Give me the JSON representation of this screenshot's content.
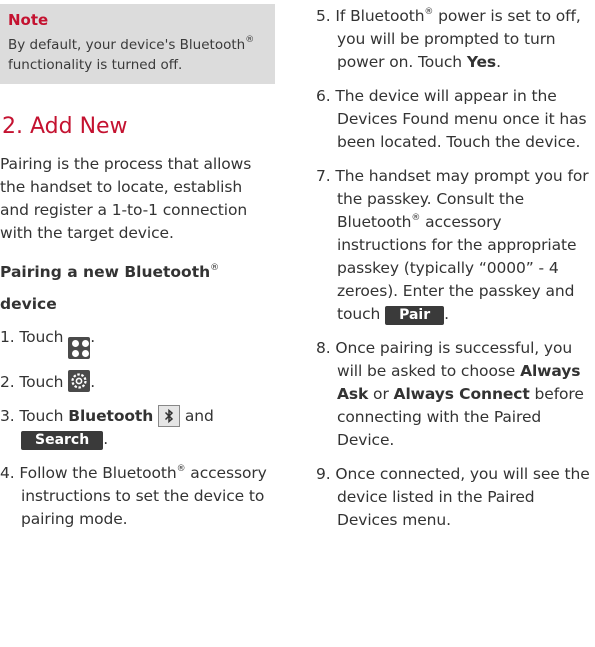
{
  "note": {
    "title": "Note",
    "text_before": "By default, your device's Bluetooth",
    "reg": "®",
    "text_after": " functionality is turned off."
  },
  "section": {
    "title": "2. Add New",
    "intro": "Pairing is the process that allows the handset to locate, establish and register a 1-to-1 connection with the target device.",
    "subhead_a": "Pairing a new Bluetooth",
    "subhead_reg": "®",
    "subhead_b": "device"
  },
  "steps": {
    "s1": {
      "num": "1.",
      "text": "Touch",
      "end": "."
    },
    "s2": {
      "num": "2.",
      "text": "Touch",
      "end": "."
    },
    "s3": {
      "num": "3.",
      "text": "Touch",
      "bold": "Bluetooth",
      "and": "and",
      "button": "Search",
      "end": "."
    },
    "s4": {
      "num": "4.",
      "text_a": "Follow the Bluetooth",
      "reg": "®",
      "text_b": " accessory instructions to set the device to pairing mode."
    },
    "s5": {
      "num": "5.",
      "text_a": "If Bluetooth",
      "reg": "®",
      "text_b": " power is set to off, you will be prompted to turn power on. Touch ",
      "bold": "Yes",
      "end": "."
    },
    "s6": {
      "num": "6.",
      "text": "The device will appear in the Devices Found menu once it has been located. Touch the device."
    },
    "s7": {
      "num": "7.",
      "text_a": "The handset may prompt you for the passkey. Consult the Bluetooth",
      "reg": "®",
      "text_b": " accessory instructions for the appropriate passkey (typically “0000” - 4 zeroes). Enter the passkey and touch",
      "button": "Pair",
      "end": "."
    },
    "s8": {
      "num": "8.",
      "text_a": "Once pairing is successful, you will be asked to choose ",
      "bold_a": "Always Ask",
      "or": " or ",
      "bold_b": "Always Connect",
      "text_b": " before connecting with the Paired Device."
    },
    "s9": {
      "num": "9.",
      "text": "Once connected, you will see the device listed in the Paired Devices menu."
    }
  },
  "icons": [
    "menu-dots-icon",
    "settings-gear-icon",
    "bluetooth-icon"
  ],
  "colors": {
    "accent": "#c41230",
    "note_bg": "#dcdcdc",
    "button_bg": "#3a3a3a"
  }
}
